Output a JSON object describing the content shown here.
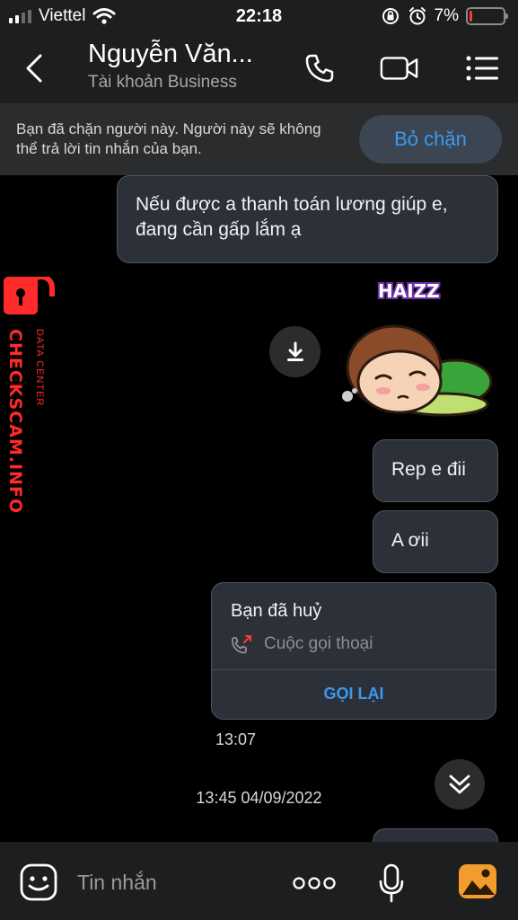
{
  "status_bar": {
    "carrier": "Viettel",
    "time": "22:18",
    "battery_percent": "7%",
    "battery_level": 0.07,
    "icons": [
      "signal-icon",
      "wifi-icon",
      "rotation-lock-icon",
      "alarm-icon",
      "battery-icon"
    ]
  },
  "header": {
    "name": "Nguyễn Văn...",
    "account_type": "Tài khoản Business",
    "icons": [
      "back-chevron-icon",
      "phone-icon",
      "video-camera-icon",
      "menu-icon"
    ]
  },
  "banner": {
    "text": "Bạn đã chặn người này. Người này sẽ không thể trả lời tin nhắn của bạn.",
    "unblock_label": "Bỏ chặn",
    "accent": "#3b99f0"
  },
  "watermark": {
    "main": "CHECKSCAM.INFO",
    "small": "DATA CENTER",
    "color": "#ff2a2a"
  },
  "messages": [
    {
      "type": "text",
      "text": "Nếu được a thanh toán lương giúp e, đang cần gấp lắm ạ"
    },
    {
      "type": "sticker",
      "label": "HAIZZ"
    },
    {
      "type": "text",
      "text": "Rep e đii"
    },
    {
      "type": "text",
      "text": "A ơii"
    },
    {
      "type": "call",
      "title": "Bạn đã huỷ",
      "detail": "Cuộc gọi thoại",
      "action": "GỌI LẠI"
    }
  ],
  "time_last": "13:07",
  "date_separator": "13:45 04/09/2022",
  "composer": {
    "placeholder": "Tin nhắn",
    "icons": [
      "emoji-icon",
      "more-dots-icon",
      "microphone-icon",
      "image-icon"
    ]
  }
}
